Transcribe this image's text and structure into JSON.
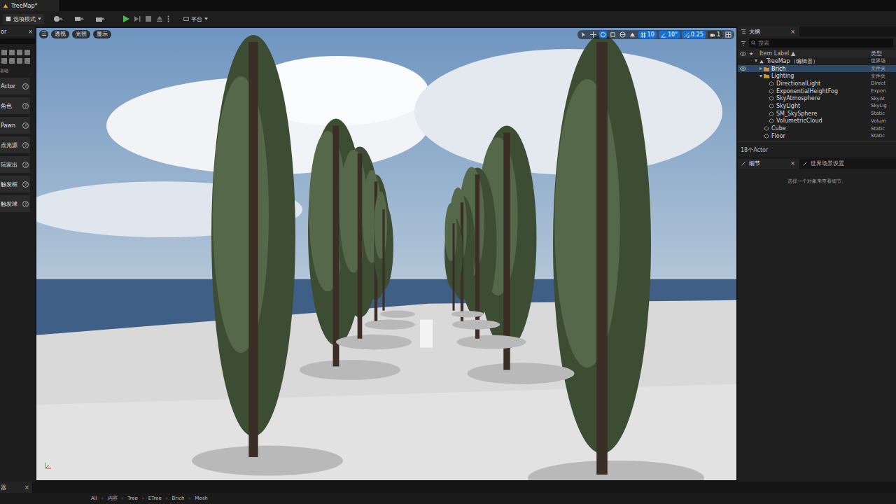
{
  "window": {
    "title": "TreeMap*"
  },
  "toolbar": {
    "mode": "选项模式",
    "platform": "平台"
  },
  "place_panel": {
    "title": "or",
    "close": "×",
    "category": "基础",
    "help": "?",
    "items": [
      {
        "label": "Actor"
      },
      {
        "label": "角色"
      },
      {
        "label": "Pawn"
      },
      {
        "label": "点光源"
      },
      {
        "label": "玩家出"
      },
      {
        "label": "触发框"
      },
      {
        "label": "触发球"
      }
    ]
  },
  "viewport": {
    "menu": "☰",
    "view": "透视",
    "lit": "光照",
    "show": "显示",
    "grid": "10",
    "angle": "10°",
    "scale": "0.25",
    "camera": "1"
  },
  "outliner": {
    "title": "大纲",
    "close": "×",
    "search": "搜索",
    "columns": [
      "Item Label ▲",
      "类型"
    ],
    "rows": [
      {
        "label": "TreeMap（编辑器）",
        "type": "世界场",
        "depth": 0,
        "kind": "world",
        "expandable": true,
        "expanded": true,
        "selected": false,
        "visible": false
      },
      {
        "label": "Brich",
        "type": "文件夹",
        "depth": 1,
        "kind": "folder",
        "expandable": true,
        "expanded": false,
        "selected": true,
        "visible": true
      },
      {
        "label": "Lighting",
        "type": "文件夹",
        "depth": 1,
        "kind": "folder",
        "expandable": true,
        "expanded": true,
        "selected": false,
        "visible": false
      },
      {
        "label": "DirectionalLight",
        "type": "Direct",
        "depth": 2,
        "kind": "actor",
        "expandable": false,
        "expanded": false,
        "selected": false,
        "visible": false
      },
      {
        "label": "ExponentialHeightFog",
        "type": "Expon",
        "depth": 2,
        "kind": "actor",
        "expandable": false,
        "expanded": false,
        "selected": false,
        "visible": false
      },
      {
        "label": "SkyAtmosphere",
        "type": "SkyAt",
        "depth": 2,
        "kind": "actor",
        "expandable": false,
        "expanded": false,
        "selected": false,
        "visible": false
      },
      {
        "label": "SkyLight",
        "type": "SkyLig",
        "depth": 2,
        "kind": "actor",
        "expandable": false,
        "expanded": false,
        "selected": false,
        "visible": false
      },
      {
        "label": "SM_SkySphere",
        "type": "Static",
        "depth": 2,
        "kind": "actor",
        "expandable": false,
        "expanded": false,
        "selected": false,
        "visible": false
      },
      {
        "label": "VolumetricCloud",
        "type": "Volum",
        "depth": 2,
        "kind": "actor",
        "expandable": false,
        "expanded": false,
        "selected": false,
        "visible": false
      },
      {
        "label": "Cube",
        "type": "Static",
        "depth": 1,
        "kind": "actor",
        "expandable": false,
        "expanded": false,
        "selected": false,
        "visible": false
      },
      {
        "label": "Floor",
        "type": "Static",
        "depth": 1,
        "kind": "actor",
        "expandable": false,
        "expanded": false,
        "selected": false,
        "visible": false
      }
    ],
    "count": "18个Actor"
  },
  "details": {
    "tabs": [
      {
        "label": "细节",
        "selected": true,
        "closable": true
      },
      {
        "label": "世界场景设置",
        "selected": false,
        "closable": false
      }
    ],
    "close": "×",
    "empty": "选择一个对象来查看细节。"
  },
  "content_browser": {
    "title": "器",
    "close": "×",
    "separator": "›",
    "path": [
      "All",
      "内容",
      "Tree",
      "ETree",
      "Brich",
      "Mesh"
    ]
  }
}
